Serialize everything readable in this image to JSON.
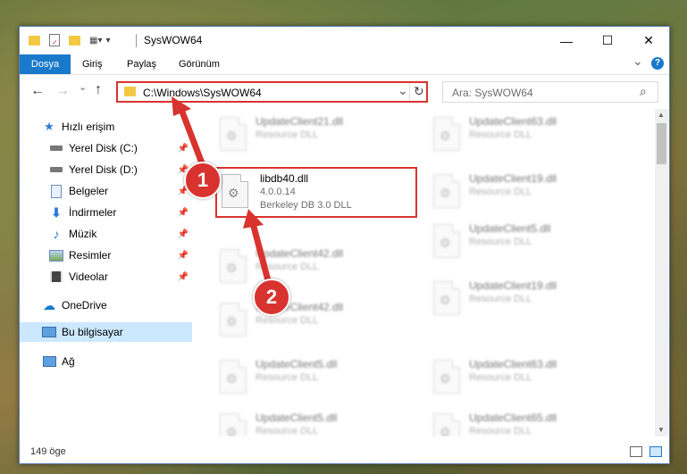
{
  "window": {
    "title": "SysWOW64",
    "minimize": "—",
    "maximize": "☐",
    "close": "✕"
  },
  "ribbon": {
    "tabs": [
      "Dosya",
      "Giriş",
      "Paylaş",
      "Görünüm"
    ],
    "collapse": "⌄",
    "help": "?"
  },
  "nav": {
    "back": "←",
    "forward": "→",
    "recent": "⌄",
    "up": "↑"
  },
  "address": {
    "path": "C:\\Windows\\SysWOW64",
    "dropdown": "⌄",
    "refresh": "↻"
  },
  "search": {
    "placeholder": "Ara: SysWOW64",
    "icon": "⌕"
  },
  "sidebar": {
    "items": [
      {
        "label": "Hızlı erişim",
        "icon": "star-icon"
      },
      {
        "label": "Yerel Disk (C:)",
        "icon": "drive-icon",
        "pinned": true
      },
      {
        "label": "Yerel Disk (D:)",
        "icon": "drive-icon",
        "pinned": true
      },
      {
        "label": "Belgeler",
        "icon": "documents-icon",
        "pinned": true
      },
      {
        "label": "İndirmeler",
        "icon": "download-icon",
        "pinned": true
      },
      {
        "label": "Müzik",
        "icon": "music-icon",
        "pinned": true
      },
      {
        "label": "Resimler",
        "icon": "pictures-icon",
        "pinned": true
      },
      {
        "label": "Videolar",
        "icon": "videos-icon",
        "pinned": true
      },
      {
        "label": "OneDrive",
        "icon": "cloud-icon"
      },
      {
        "label": "Bu bilgisayar",
        "icon": "computer-icon",
        "selected": true
      },
      {
        "label": "Ağ",
        "icon": "network-icon"
      }
    ]
  },
  "files": {
    "highlighted": {
      "name": "libdb40.dll",
      "version": "4.0.0.14",
      "description": "Berkeley DB 3.0 DLL"
    },
    "left": [
      {
        "name": "UpdateClient21.dll",
        "description": "Resource DLL"
      },
      {
        "name": "UpdateClient42.dll",
        "description": "Resource DLL"
      },
      {
        "name": "UpdateClient42.dll",
        "description": "Resource DLL"
      },
      {
        "name": "UpdateClient5.dll",
        "description": "Resource DLL"
      },
      {
        "name": "UpdateClient5.dll",
        "description": "Resource DLL"
      }
    ],
    "right": [
      {
        "name": "UpdateClient63.dll",
        "description": "Resource DLL"
      },
      {
        "name": "UpdateClient19.dll",
        "description": "Resource DLL"
      },
      {
        "name": "UpdateClient5.dll",
        "description": "Resource DLL"
      },
      {
        "name": "UpdateClient19.dll",
        "description": "Resource DLL"
      },
      {
        "name": "UpdateClient63.dll",
        "description": "Resource DLL"
      },
      {
        "name": "UpdateClient65.dll",
        "description": "Resource DLL"
      }
    ]
  },
  "status": {
    "count": "149 öge"
  },
  "annotations": {
    "badge1": "1",
    "badge2": "2",
    "color": "#d9332f"
  }
}
